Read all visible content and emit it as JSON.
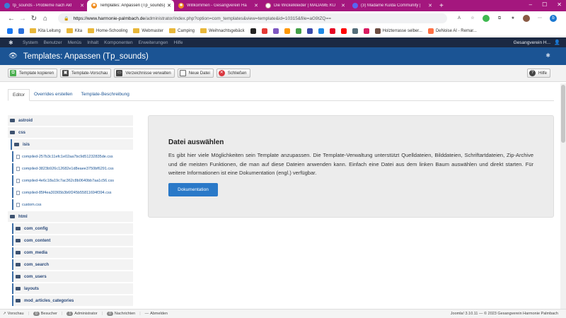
{
  "browser": {
    "tabs": [
      {
        "title": "tp_sounds - Probleme nach Akt",
        "favicon": "#3a7bd5",
        "active": false
      },
      {
        "title": "Templates: Anpassen (Tp_sounds)",
        "favicon": "#f08c1f",
        "active": true
      },
      {
        "title": "Willkommen - Gesangverein Ha",
        "favicon": "#f08c1f",
        "active": false
      },
      {
        "title": "Die Wickelkleider | MADAME KU",
        "favicon": "#ffffff",
        "active": false
      },
      {
        "title": "(3) Madame Kulda Community |",
        "favicon": "#5865f2",
        "active": false
      }
    ],
    "new_tab": "+",
    "window_controls": [
      "–",
      "☐",
      "✕"
    ],
    "url_host": "https://www.harmonie-palmbach.de",
    "url_path": "/administrator/index.php?option=com_templates&view=template&id=10315&file=aG9tZQ==",
    "nav": [
      "←",
      "→",
      "↻",
      "⌂"
    ],
    "bookmarks": [
      {
        "label": "",
        "type": "icon",
        "color": "#1877f2"
      },
      {
        "label": "",
        "type": "icon",
        "color": "#2a6fdb"
      },
      {
        "label": "Kita Leitung",
        "type": "folder"
      },
      {
        "label": "Kita",
        "type": "folder"
      },
      {
        "label": "Home-Schooling",
        "type": "folder"
      },
      {
        "label": "Webmaster",
        "type": "folder"
      },
      {
        "label": "Camping",
        "type": "folder"
      },
      {
        "label": "Weihnachtsgebäck",
        "type": "folder"
      },
      {
        "label": "Holzterrasse selber...",
        "type": "link"
      },
      {
        "label": "DeNoise AI - Remar...",
        "type": "link"
      }
    ]
  },
  "joomla": {
    "menu": [
      "System",
      "Benutzer",
      "Menüs",
      "Inhalt",
      "Komponenten",
      "Erweiterungen",
      "Hilfe"
    ],
    "site_name": "Gesangverein H...",
    "page_title": "Templates: Anpassen (Tp_sounds)",
    "toolbar": {
      "copy": "Template kopieren",
      "preview": "Template-Vorschau",
      "folders": "Verzeichnisse verwalten",
      "new_file": "Neue Datei",
      "close": "Schließen",
      "help": "Hilfe"
    },
    "subtabs": [
      "Editor",
      "Overrides erstellen",
      "Template-Beschreibung"
    ],
    "tree": {
      "astroid": "astroid",
      "css": "css",
      "isis": "isis",
      "files": [
        "compiled-257b3c11efc1e02aa7bc9d51232835de.css",
        "compiled-3823b926c12682e1d8eaee3750bf6291.css",
        "compiled-4e6c18a19c7ac362c8b0640bb7aa1c56.css",
        "compiled-85f4ea30365b3b6f245b55811694f394.css",
        "custom.css"
      ],
      "html": "html",
      "html_children": [
        "com_config",
        "com_content",
        "com_media",
        "com_search",
        "com_users",
        "layouts",
        "mod_articles_categories"
      ]
    },
    "info": {
      "heading": "Datei auswählen",
      "text": "Es gibt hier viele Möglichkeiten sein Template anzupassen. Die Template-Verwaltung unterstützt Quelldateien, Bilddateien, Schriftartdateien, Zip-Archive und die meisten Funktionen, die man auf diese Dateien anwenden kann. Einfach eine Datei aus dem linken Baum auswählen und direkt starten. Für weitere Informationen ist eine Dokumentation (engl.) verfügbar.",
      "button": "Dokumentation"
    },
    "status": {
      "preview": "Vorschau",
      "visitors_count": "0",
      "visitors": "Besucher",
      "admin_count": "1",
      "admin": "Administrator",
      "messages_count": "0",
      "messages": "Nachrichten",
      "logout": "Abmelden",
      "footer": "Joomla! 3.10.11 — © 2023 Gesangverein Harmonie Palmbach"
    }
  }
}
